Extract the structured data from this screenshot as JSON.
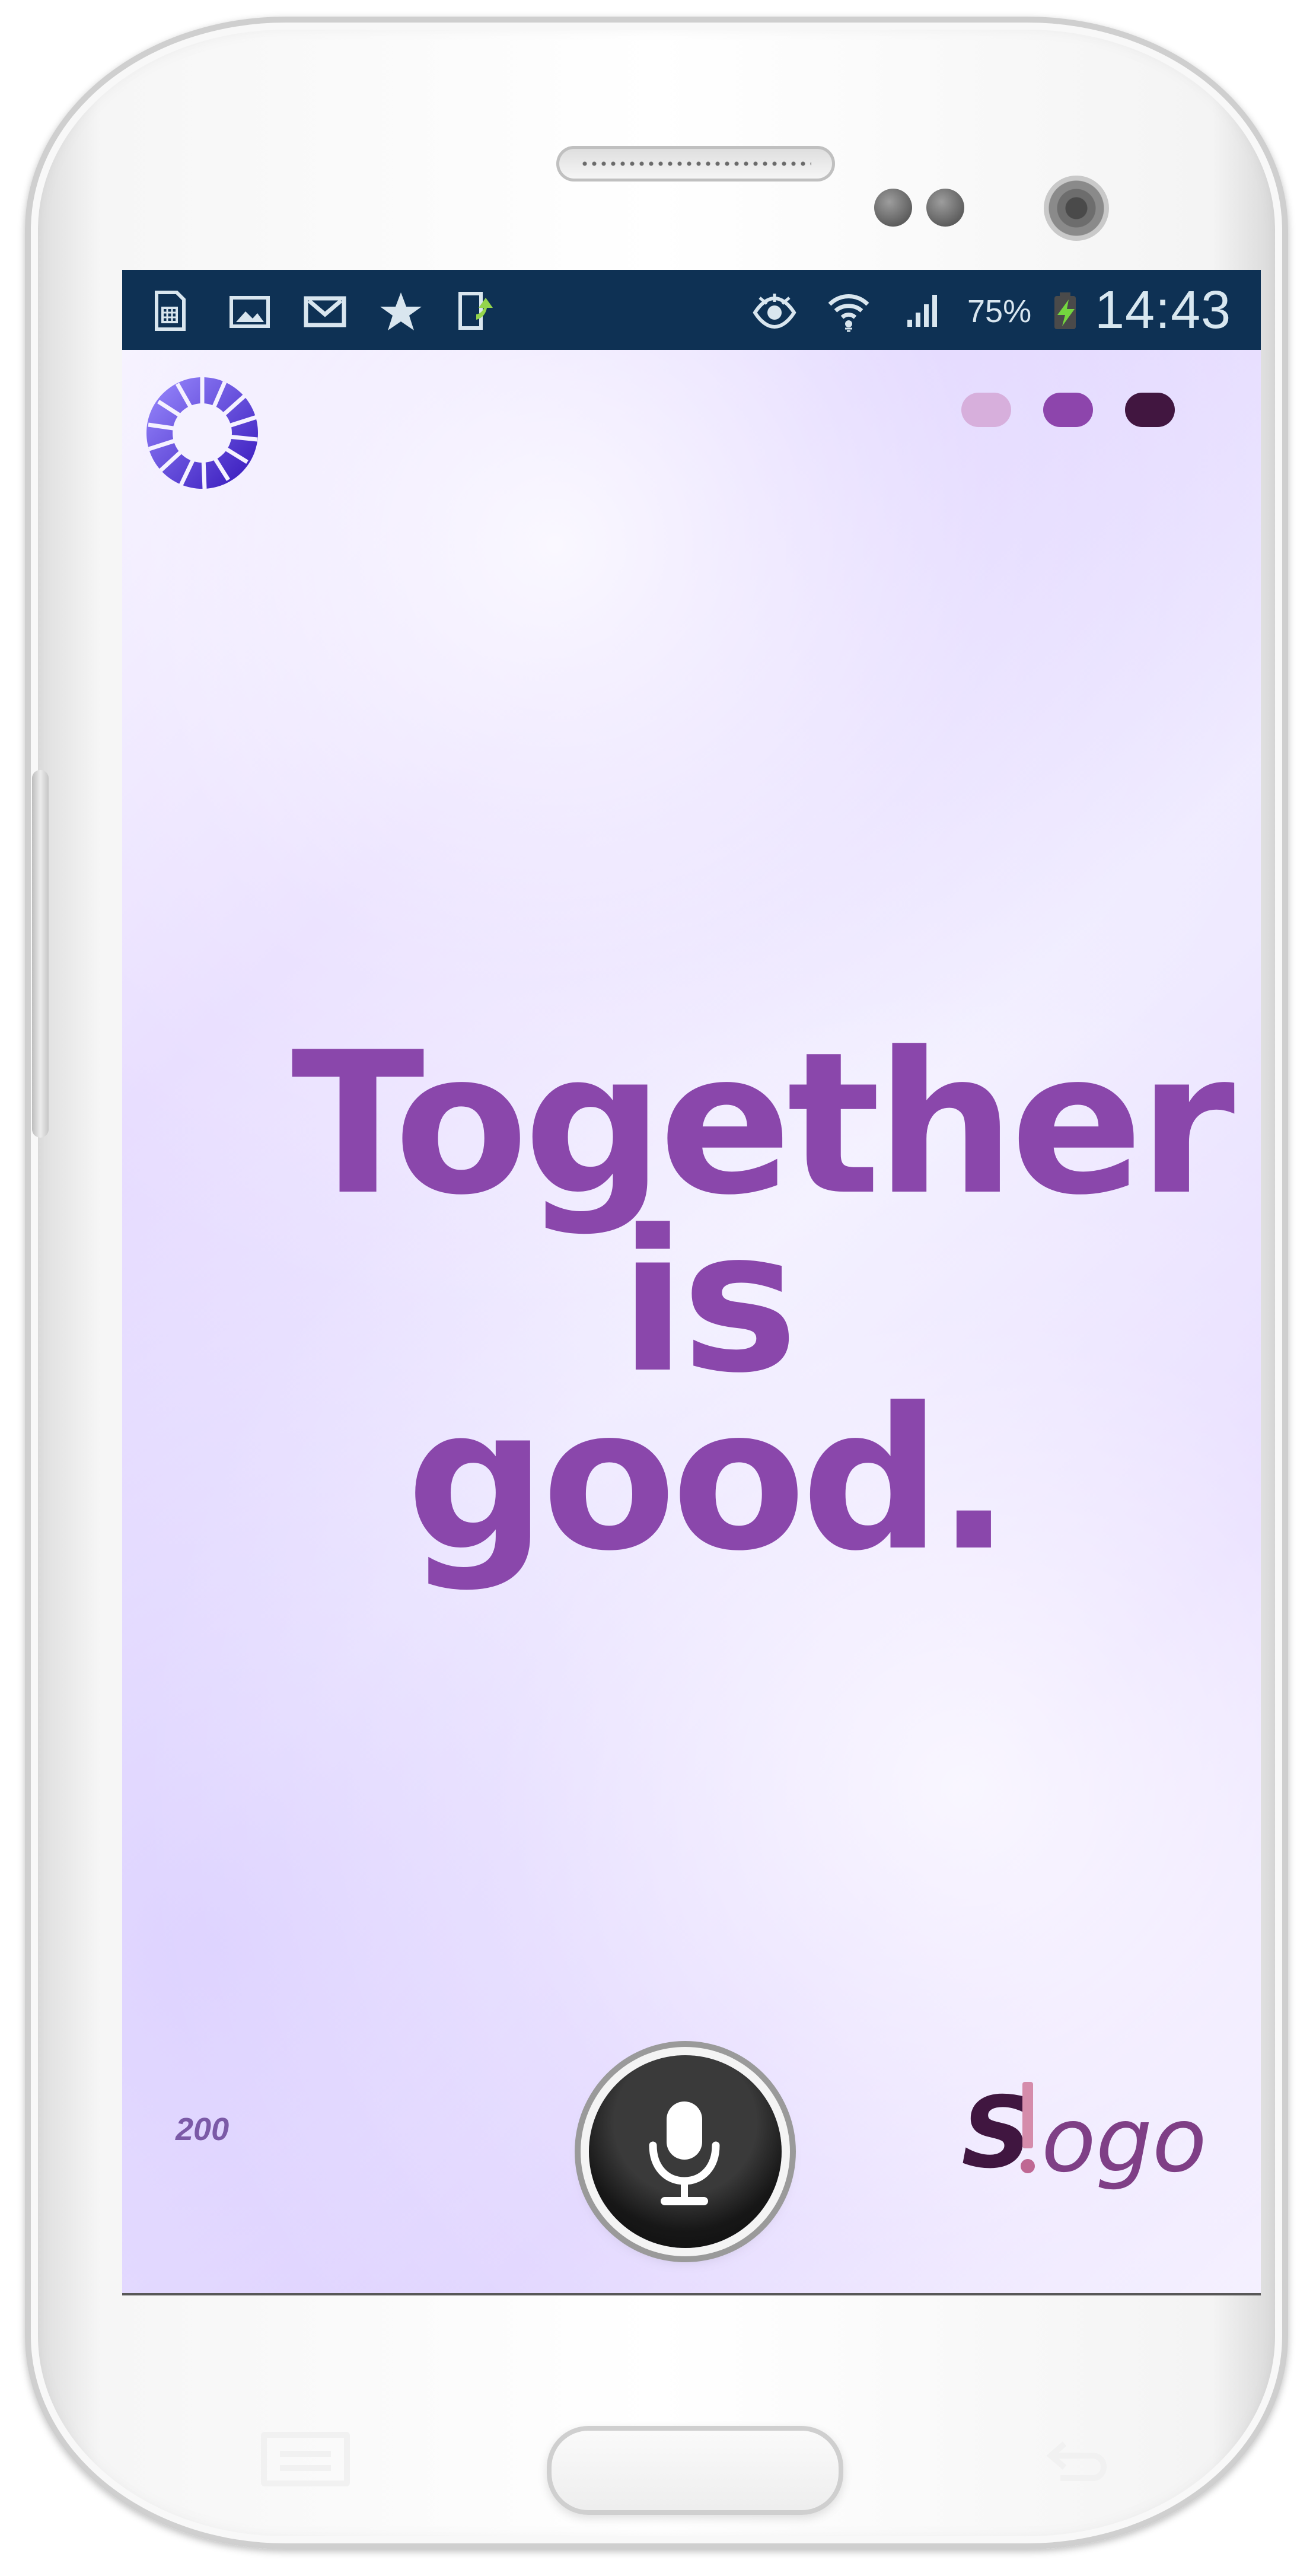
{
  "status_bar": {
    "battery_percent": "75%",
    "time": "14:43",
    "icons": [
      "sim-card-icon",
      "image-icon",
      "gmail-icon",
      "star-icon",
      "upload-icon",
      "eye-icon",
      "wifi-icon",
      "signal-icon",
      "charging-icon"
    ]
  },
  "app": {
    "headline": "Together\nis good.",
    "count": "200",
    "brand": {
      "s": "S",
      "rest": "ogo",
      "icon": "exclamation-mark"
    },
    "page_indicator_colors": [
      "#d7afdc",
      "#8d45ac",
      "#411640"
    ],
    "accent_color": "#8a47ab"
  },
  "navigation": {
    "home_icon": "home-button",
    "back_icon": "back-icon",
    "recent_icon": "recent-apps-icon"
  }
}
